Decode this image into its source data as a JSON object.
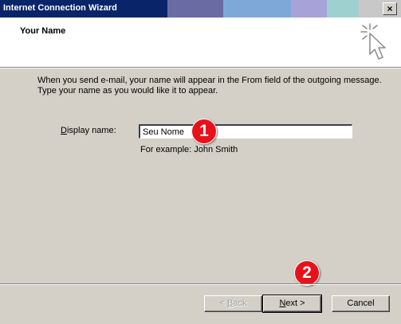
{
  "window": {
    "title": "Internet Connection Wizard",
    "close_label": "×"
  },
  "header": {
    "title": "Your Name",
    "icon": "wizard-cursor-icon"
  },
  "content": {
    "description_line1": "When you send e-mail, your name will appear in the From field of the outgoing message.",
    "description_line2": "Type your name as you would like it to appear.",
    "display_name_label_accel": "D",
    "display_name_label_rest": "isplay name:",
    "display_name_value": "Seu Nome",
    "example_text": "For example: John Smith"
  },
  "annotations": {
    "badge1": "1",
    "badge2": "2"
  },
  "buttons": {
    "back_accel": "B",
    "back_prefix": "< ",
    "back_rest": "ack",
    "next_accel": "N",
    "next_rest": "ext >",
    "cancel": "Cancel"
  }
}
